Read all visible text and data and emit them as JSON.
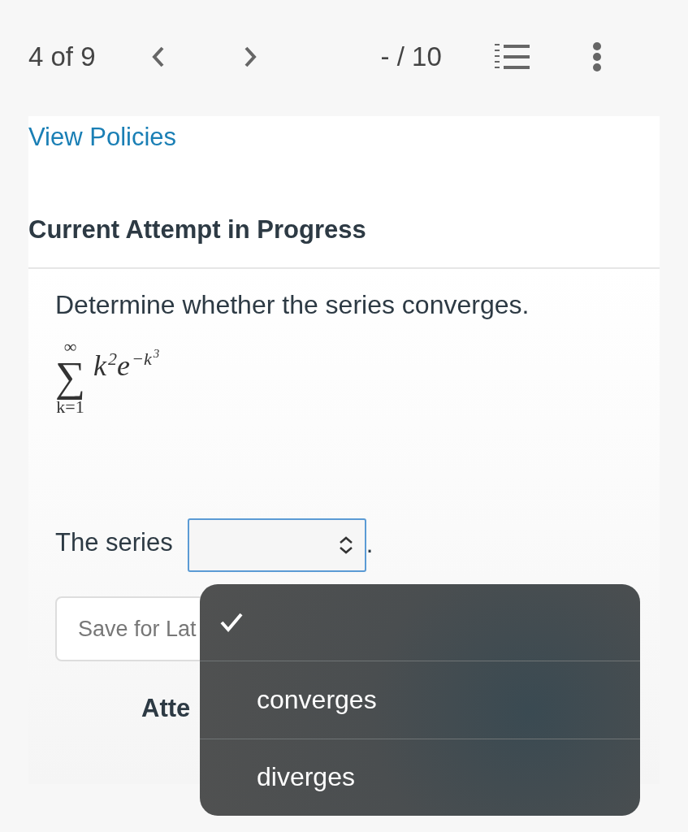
{
  "nav": {
    "position": "4 of 9",
    "score": "- / 10"
  },
  "policies_link": "View Policies",
  "section_title": "Current Attempt in Progress",
  "question": {
    "prompt": "Determine whether the series converges.",
    "formula": {
      "operator": "∑",
      "upper": "∞",
      "lower": "k=1",
      "terms": [
        {
          "base": "k",
          "exp": "2"
        },
        {
          "base": "e",
          "exp": "−k",
          "exp2": "3"
        }
      ]
    },
    "answer_label": "The series",
    "answer_suffix": "."
  },
  "save_button": "Save for Lat",
  "attempts_label": "Atte",
  "dropdown": {
    "options": [
      {
        "selected": true
      },
      {
        "label": "converges",
        "selected": false
      },
      {
        "label": "diverges",
        "selected": false
      }
    ]
  }
}
